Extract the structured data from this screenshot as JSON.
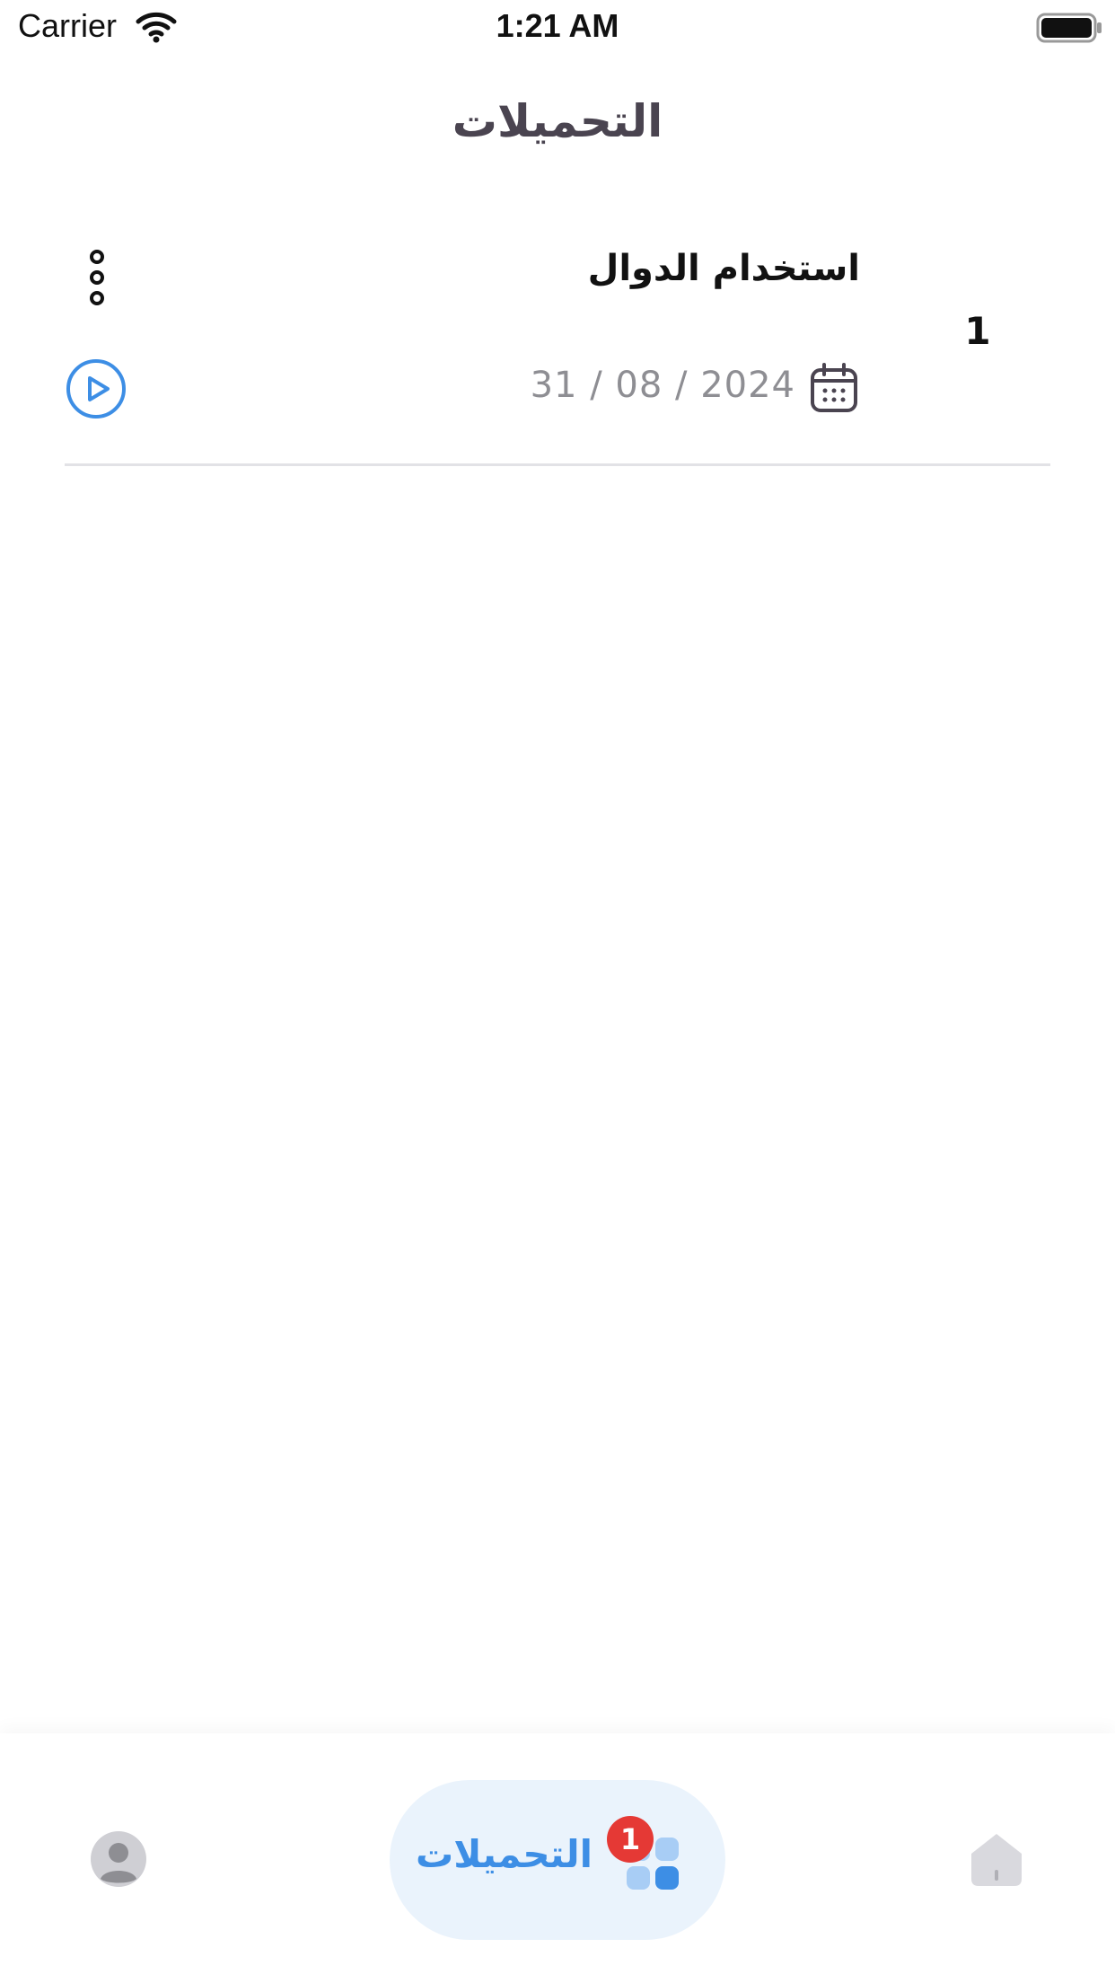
{
  "status_bar": {
    "carrier": "Carrier",
    "time": "1:21 AM"
  },
  "header": {
    "title": "التحميلات"
  },
  "downloads": [
    {
      "index": "1",
      "title": "استخدام الدوال",
      "date": "31 / 08 / 2024"
    }
  ],
  "tab_bar": {
    "downloads_label": "التحميلات",
    "downloads_badge": "1"
  },
  "colors": {
    "accent": "#3d8ee5",
    "badge": "#e53935",
    "title": "#4a4450",
    "muted": "#8e8e93",
    "tab_active_bg": "#eaf3fc"
  },
  "icons": [
    "wifi-icon",
    "battery-icon",
    "more-vertical-icon",
    "play-circle-icon",
    "calendar-icon",
    "profile-icon",
    "grid-icon",
    "home-icon"
  ]
}
